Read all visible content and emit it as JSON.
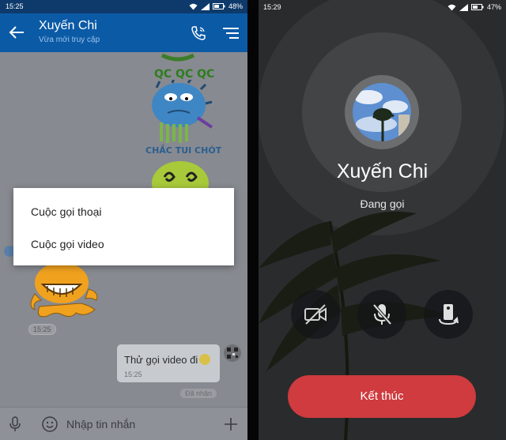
{
  "left_screen": {
    "status_bar": {
      "time": "15:25",
      "battery": "48%"
    },
    "header": {
      "contact_name": "Xuyến Chi",
      "last_seen": "Vừa mới truy cập"
    },
    "stickers": {
      "caption_1": "QC QC QC",
      "caption_2": "CHẮC TUI CHÓT"
    },
    "timestamp_pill": "15:25",
    "outgoing_message": {
      "text": "Thử gọi video đi",
      "time": "15:25"
    },
    "delivery_status": "Đã nhận",
    "composer": {
      "placeholder": "Nhập tin nhắn"
    },
    "call_dialog": {
      "options": [
        "Cuộc gọi thoại",
        "Cuộc gọi video"
      ]
    },
    "icons": [
      "back-arrow-icon",
      "phone-icon",
      "menu-icon",
      "mic-icon",
      "smiley-icon",
      "plus-icon"
    ]
  },
  "right_screen": {
    "status_bar": {
      "time": "15:29",
      "battery": "47%"
    },
    "callee_name": "Xuyến Chi",
    "call_status": "Đang gọi",
    "controls": [
      "video-off-icon",
      "mic-off-icon",
      "switch-camera-icon"
    ],
    "end_call_label": "Kết thúc",
    "colors": {
      "end_button": "#cf3b3e",
      "header": "#0b5aa6"
    }
  }
}
